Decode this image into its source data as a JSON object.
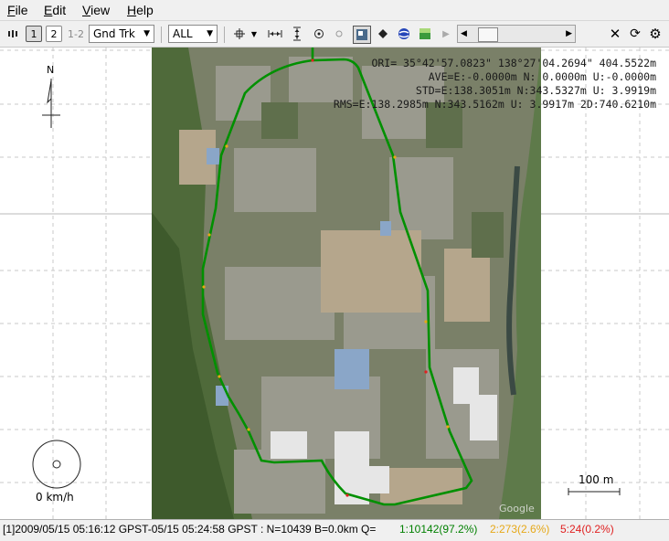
{
  "menu": {
    "file": "File",
    "edit": "Edit",
    "view": "View",
    "help": "Help"
  },
  "toolbar": {
    "btn_1": "1",
    "btn_2": "2",
    "btn_12": "1-2",
    "plot_type": "Gnd Trk",
    "quality_filter": "ALL"
  },
  "plot": {
    "north_label": "N",
    "ori": "ORI= 35°42'57.0823\" 138°27'04.2694\" 404.5522m",
    "ave": "AVE=E:-0.0000m N: 0.0000m U:-0.0000m",
    "std": "STD=E:138.3051m N:343.5327m U: 3.9919m",
    "rms": "RMS=E:138.2985m N:343.5162m U: 3.9917m 2D:740.6210m",
    "speed": "0 km/h",
    "scale": "100 m",
    "watermark": "Google"
  },
  "status": {
    "info": "[1]2009/05/15 05:16:12 GPST-05/15 05:24:58 GPST : N=10439 B=0.0km Q=",
    "q1": "1:10142(97.2%)",
    "q2": "2:273(2.6%)",
    "q5": "5:24(0.2%)",
    "colors": {
      "q1": "#008000",
      "q2": "#e6a817",
      "q5": "#e02020"
    }
  }
}
